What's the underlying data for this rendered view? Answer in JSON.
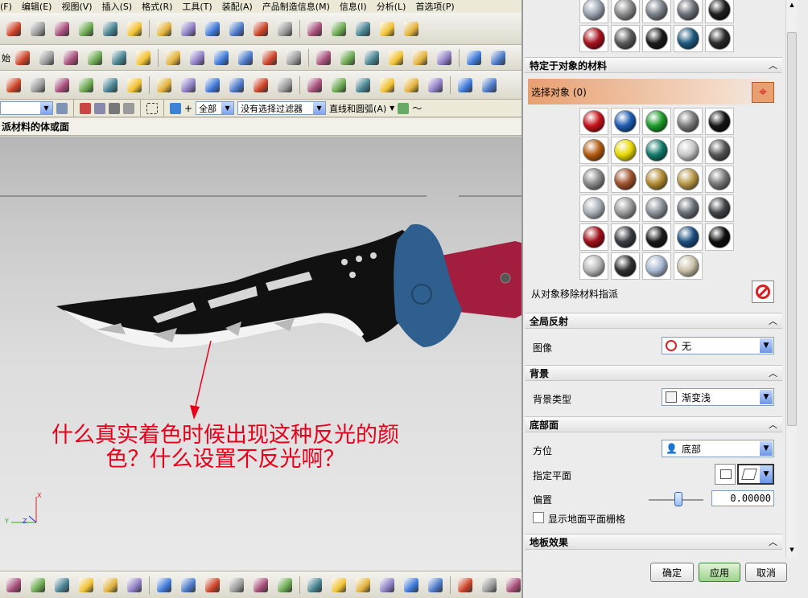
{
  "menubar": {
    "items": [
      "(F)",
      "编辑(E)",
      "视图(V)",
      "插入(S)",
      "格式(R)",
      "工具(T)",
      "装配(A)",
      "产品制造信息(M)",
      "信息(I)",
      "分析(L)",
      "首选项(P)"
    ]
  },
  "toolbar_row2": {
    "prefix": "始"
  },
  "filter_bar": {
    "scope_value": "全部",
    "type_filter_value": "没有选择过滤器",
    "curve_rule_label": "直线和圆弧(A)"
  },
  "cue_line": {
    "text": "派材料的体或面"
  },
  "viewport": {
    "annotation_text": "什么真实着色时候出现这种反光的颜色？什么设置不反光啊？",
    "triad": {
      "x_label": "X",
      "y_label": "Y",
      "z_label": "Z"
    },
    "colors": {
      "knife_guard": "#2f5f8f",
      "knife_handle": "#a31d3e",
      "knife_blade": "#111111",
      "annotation": "#e8001a"
    }
  },
  "panel": {
    "object_materials_title": "特定于对象的材料",
    "select_object_label": "选择对象 (0)",
    "remove_material_label": "从对象移除材料指派",
    "global_reflection": {
      "title": "全局反射",
      "image_label": "图像",
      "image_value": "无"
    },
    "background": {
      "title": "背景",
      "type_label": "背景类型",
      "type_value": "渐变浅"
    },
    "base_plane": {
      "title": "底部面",
      "orientation_label": "方位",
      "orientation_value": "底部",
      "specify_plane_label": "指定平面",
      "offset_label": "偏置",
      "offset_value": "0.00000",
      "offset_slider_fraction": 0.55,
      "show_grid_label": "显示地面平面栅格",
      "show_grid_checked": false
    },
    "floor_effect": {
      "title": "地板效果"
    },
    "buttons": {
      "ok": "确定",
      "apply": "应用",
      "cancel": "取消"
    },
    "accent_color": "#e8a070"
  }
}
